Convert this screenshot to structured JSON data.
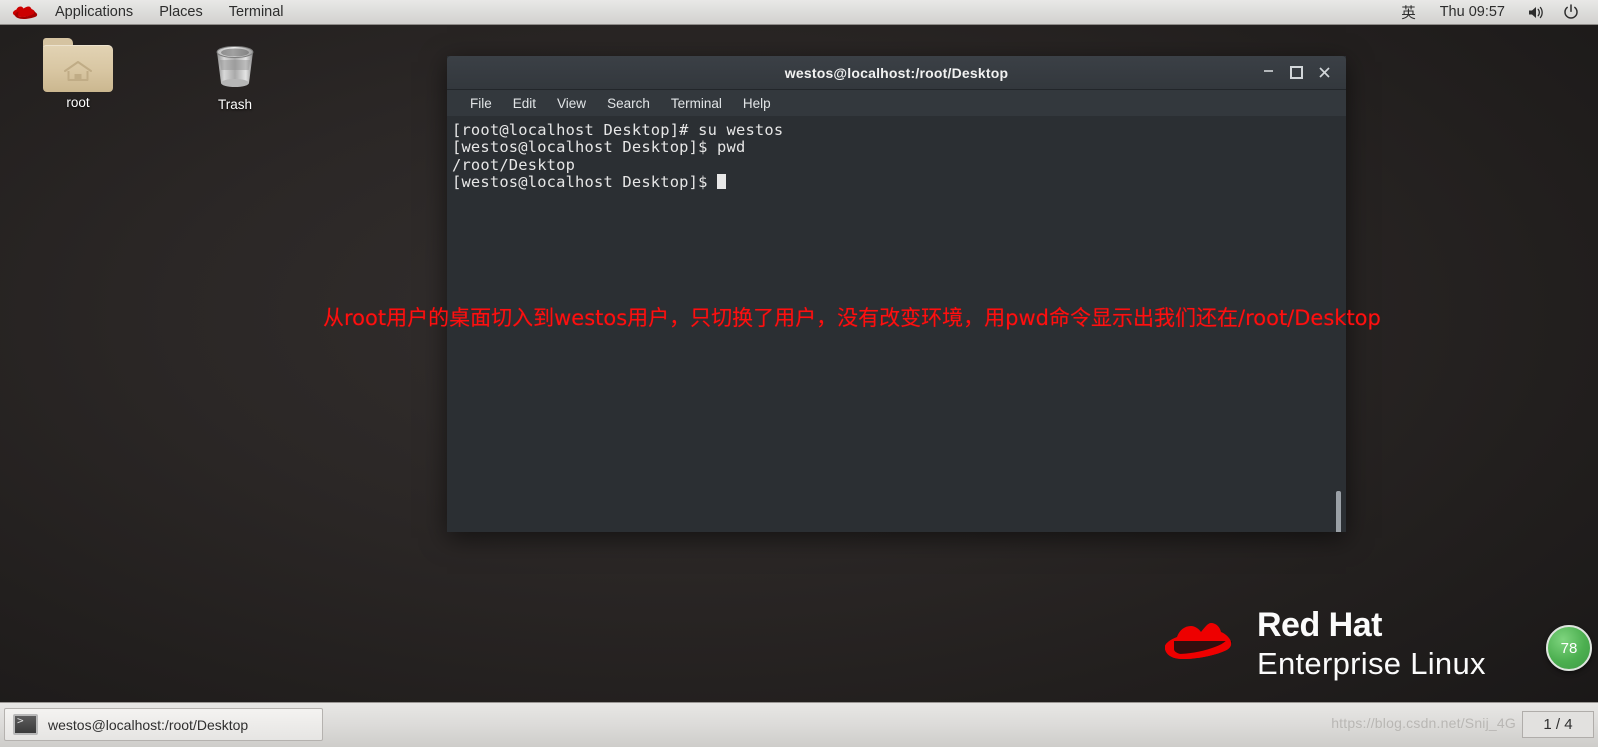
{
  "top_panel": {
    "logo_icon": "redhat-logo-icon",
    "items": [
      {
        "label": "Applications",
        "name": "applications-menu"
      },
      {
        "label": "Places",
        "name": "places-menu"
      },
      {
        "label": "Terminal",
        "name": "terminal-menu"
      }
    ],
    "ime": "英",
    "clock": "Thu 09:57",
    "volume_icon": "volume-icon",
    "power_icon": "power-icon"
  },
  "desktop": {
    "icons": [
      {
        "label": "root",
        "type": "home-folder-icon"
      },
      {
        "label": "Trash",
        "type": "trash-icon"
      }
    ]
  },
  "terminal": {
    "title": "westos@localhost:/root/Desktop",
    "window_controls": {
      "minimize": "–",
      "maximize": "□",
      "close": "×"
    },
    "menu": [
      "File",
      "Edit",
      "View",
      "Search",
      "Terminal",
      "Help"
    ],
    "lines": [
      "[root@localhost Desktop]# su westos",
      "[westos@localhost Desktop]$ pwd",
      "/root/Desktop",
      "[westos@localhost Desktop]$ "
    ],
    "colors": {
      "background": "#2b2f33",
      "foreground": "#e6e6e6",
      "titlebar": "#33383d"
    }
  },
  "annotation": {
    "text": "从root用户的桌面切入到westos用户，只切换了用户，没有改变环境，用pwd命令显示出我们还在/root/Desktop",
    "color": "#ff0f0f"
  },
  "watermark": {
    "brand_line1": "Red Hat",
    "brand_line2": "Enterprise Linux",
    "brand_color": "#ee0000",
    "csdn": "https://blog.csdn.net/Snij_4G"
  },
  "badge": {
    "value": "78",
    "color": "#4caf50"
  },
  "bottom_panel": {
    "task_label": "westos@localhost:/root/Desktop",
    "task_icon": "terminal-icon",
    "workspace": "1 / 4"
  }
}
